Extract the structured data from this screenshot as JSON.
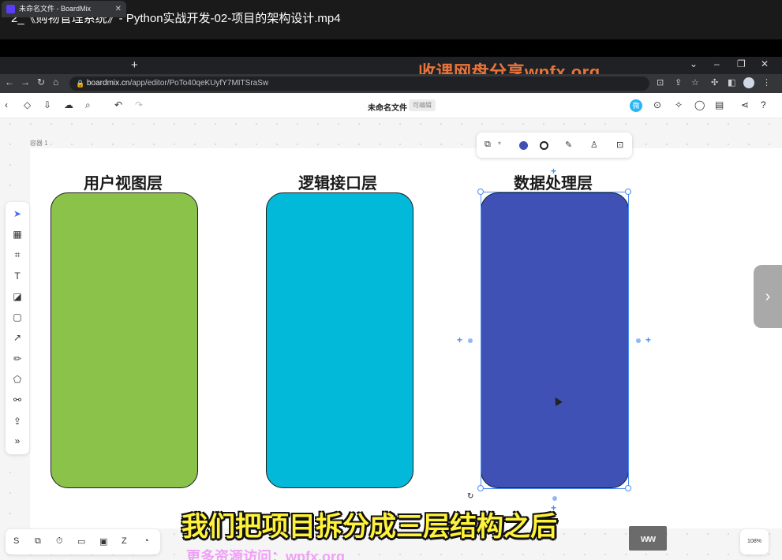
{
  "video": {
    "title": "2_《购物管理系统》- Python实战开发-02-项目的架构设计.mp4"
  },
  "browser": {
    "tab_title": "未命名文件 - BoardMix",
    "url_host": "boardmix.cn",
    "url_path": "/app/editor/PoTo40qeKUyfY7MITSraSw",
    "watermark": "收课网盘分享wpfx.org"
  },
  "app": {
    "doc_title": "未命名文件",
    "doc_badge": "可编辑",
    "avatar_initial": "微",
    "container_label": "容器 1",
    "zoom": "108%",
    "layers": [
      {
        "title": "用户视图层",
        "color": "#8bc34a"
      },
      {
        "title": "逻辑接口层",
        "color": "#03b9d9"
      },
      {
        "title": "数据处理层",
        "color": "#3f51b5"
      }
    ],
    "selected_color": "#3f51b5"
  },
  "overlay": {
    "subtitle": "我们把项目拆分成三层结构之后",
    "subtitle_partial": "更多资源访问：wpfx.org",
    "logo": "ww"
  }
}
